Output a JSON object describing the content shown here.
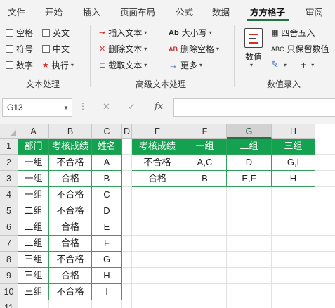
{
  "tabs": [
    "文件",
    "开始",
    "插入",
    "页面布局",
    "公式",
    "数据",
    "方方格子",
    "审阅"
  ],
  "active_tab": "方方格子",
  "ribbon": {
    "text_processing": {
      "checkboxes": [
        "空格",
        "英文",
        "符号",
        "中文",
        "数字"
      ],
      "execute": "执行",
      "label": "文本处理"
    },
    "advanced_text": {
      "insert_text": "插入文本",
      "delete_text": "删除文本",
      "extract_text": "截取文本",
      "case": "大小写",
      "delete_space": "删除空格",
      "more": "更多",
      "label": "高级文本处理"
    },
    "number_entry": {
      "numeric": "数值",
      "round": "四舍五入",
      "keep_value": "只保留数值",
      "label": "数值录入"
    }
  },
  "formula_bar": {
    "name_box": "G13",
    "fx": "fx",
    "formula": ""
  },
  "grid": {
    "columns": [
      "A",
      "B",
      "C",
      "D",
      "E",
      "F",
      "G",
      "H"
    ],
    "selected_column": "G",
    "rows": [
      "1",
      "2",
      "3",
      "4",
      "5",
      "6",
      "7",
      "8",
      "9",
      "10",
      "11"
    ],
    "table1": {
      "headers": [
        "部门",
        "考核成绩",
        "姓名"
      ],
      "rows": [
        [
          "一组",
          "不合格",
          "A"
        ],
        [
          "一组",
          "合格",
          "B"
        ],
        [
          "一组",
          "不合格",
          "C"
        ],
        [
          "二组",
          "不合格",
          "D"
        ],
        [
          "二组",
          "合格",
          "E"
        ],
        [
          "二组",
          "合格",
          "F"
        ],
        [
          "三组",
          "不合格",
          "G"
        ],
        [
          "三组",
          "合格",
          "H"
        ],
        [
          "三组",
          "不合格",
          "I"
        ]
      ]
    },
    "table2": {
      "headers": [
        "考核成绩",
        "一组",
        "二组",
        "三组"
      ],
      "rows": [
        [
          "不合格",
          "A,C",
          "D",
          "G,I"
        ],
        [
          "合格",
          "B",
          "E,F",
          "H"
        ]
      ]
    }
  },
  "colors": {
    "accent": "#217346",
    "table_header": "#14a251",
    "table_border": "#31a35a"
  }
}
